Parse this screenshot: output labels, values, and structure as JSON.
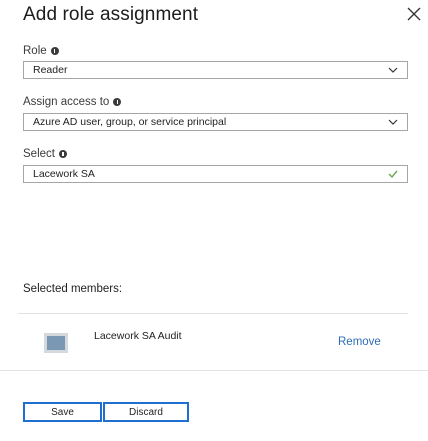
{
  "header": {
    "title": "Add role assignment"
  },
  "fields": {
    "role": {
      "label": "Role",
      "value": "Reader"
    },
    "assign_access": {
      "label": "Assign access to",
      "value": "Azure AD user, group, or service principal"
    },
    "select": {
      "label": "Select",
      "value": "Lacework SA"
    }
  },
  "members": {
    "header": "Selected members:",
    "items": [
      {
        "name": "Lacework SA Audit",
        "action": "Remove"
      }
    ]
  },
  "footer": {
    "save_label": "Save",
    "discard_label": "Discard"
  },
  "colors": {
    "accent": "#1f6fd0",
    "link": "#2d6db6",
    "valid_check": "#6aa84f"
  },
  "icons": {
    "close": "close-icon",
    "info": "info-icon",
    "chevron": "chevron-down-icon",
    "valid": "checkmark-icon",
    "avatar": "service-principal-icon"
  }
}
